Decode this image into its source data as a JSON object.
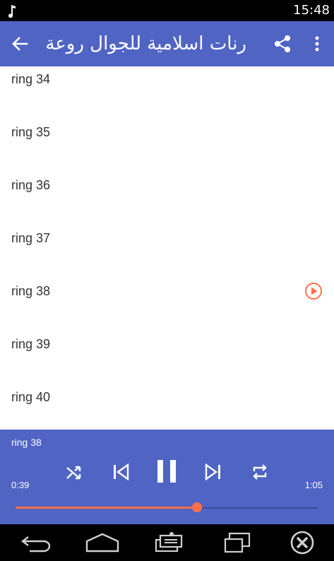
{
  "status_bar": {
    "time": "15:48",
    "icons": [
      "music-note-icon"
    ]
  },
  "app_bar": {
    "title": "رنات اسلامية للجوال روعة",
    "icons": [
      "back-arrow-icon",
      "share-icon",
      "more-vert-icon"
    ]
  },
  "list": {
    "items": [
      {
        "label": "ring 34",
        "playing": false
      },
      {
        "label": "ring 35",
        "playing": false
      },
      {
        "label": "ring 36",
        "playing": false
      },
      {
        "label": "ring 37",
        "playing": false
      },
      {
        "label": "ring 38",
        "playing": true
      },
      {
        "label": "ring 39",
        "playing": false
      },
      {
        "label": "ring 40",
        "playing": false
      }
    ]
  },
  "player": {
    "now_playing": "ring 38",
    "current_time": "0:39",
    "duration": "1:05",
    "progress": 0.6,
    "controls": [
      "shuffle-icon",
      "previous-icon",
      "pause-icon",
      "next-icon",
      "repeat-icon"
    ]
  },
  "nav_bar": {
    "icons": [
      "back-icon",
      "home-icon",
      "menu-icon",
      "recents-icon",
      "close-icon"
    ]
  },
  "colors": {
    "primary": "#5064c3",
    "accent": "#ff6f4a",
    "status_bar": "#000000",
    "nav_bar": "#000000"
  }
}
